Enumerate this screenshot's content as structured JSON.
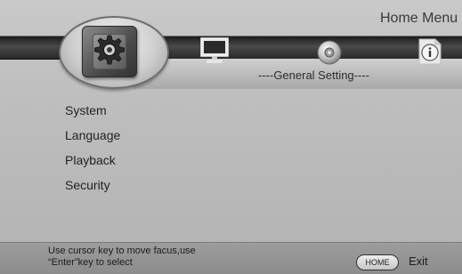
{
  "header": {
    "title": "Home Menu"
  },
  "tabs": [
    {
      "name": "general-setting",
      "icon": "gear-icon",
      "selected": true
    },
    {
      "name": "display-setting",
      "icon": "monitor-icon",
      "selected": false
    },
    {
      "name": "audio-setting",
      "icon": "disc-icon",
      "selected": false
    },
    {
      "name": "info",
      "icon": "info-icon",
      "selected": false
    }
  ],
  "section": {
    "label": "----General Setting----"
  },
  "menu": {
    "items": [
      {
        "label": "System"
      },
      {
        "label": "Language"
      },
      {
        "label": "Playback"
      },
      {
        "label": "Security"
      }
    ]
  },
  "footer": {
    "help_line1": "Use cursor key to move facus,use",
    "help_line2": "“Enter”key to select",
    "home_key": "HOME",
    "exit_label": "Exit"
  },
  "colors": {
    "background": "#bdbdbd",
    "band": "#2a2a2a",
    "text": "#222222"
  }
}
